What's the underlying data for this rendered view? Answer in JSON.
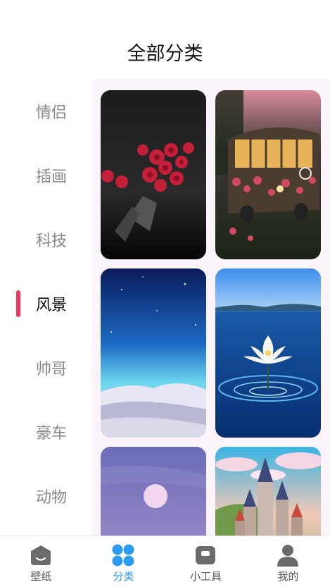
{
  "page": {
    "title": "全部分类"
  },
  "sidebar": {
    "items": [
      {
        "label": "情侣",
        "active": false
      },
      {
        "label": "插画",
        "active": false
      },
      {
        "label": "科技",
        "active": false
      },
      {
        "label": "风景",
        "active": true
      },
      {
        "label": "帅哥",
        "active": false
      },
      {
        "label": "豪车",
        "active": false
      },
      {
        "label": "动物",
        "active": false
      }
    ],
    "active_color": "#f0345a"
  },
  "grid": {
    "cards": [
      {
        "subject": "roses-bouquet-dark"
      },
      {
        "subject": "flower-bus"
      },
      {
        "subject": "desert-night-sky"
      },
      {
        "subject": "lotus-on-water"
      },
      {
        "subject": "purple-sky-moon"
      },
      {
        "subject": "fairy-castle"
      }
    ]
  },
  "tabbar": {
    "tabs": [
      {
        "label": "壁纸",
        "icon": "wallpaper-icon",
        "active": false
      },
      {
        "label": "分类",
        "icon": "category-icon",
        "active": true
      },
      {
        "label": "小工具",
        "icon": "toolbox-icon",
        "active": false
      },
      {
        "label": "我的",
        "icon": "profile-icon",
        "active": false
      }
    ],
    "active_color": "#2b9bf0",
    "inactive_color": "#555555"
  }
}
